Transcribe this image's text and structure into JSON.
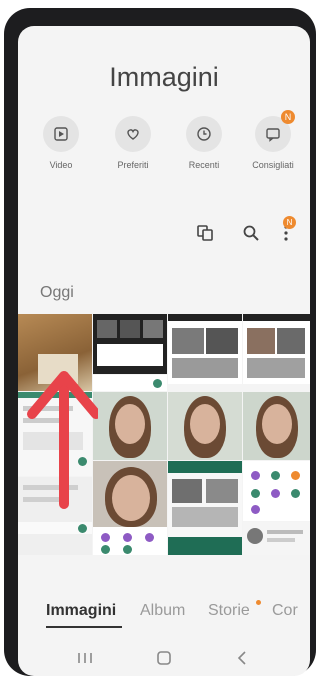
{
  "header": {
    "title": "Immagini"
  },
  "quick_actions": [
    {
      "label": "Video",
      "icon": "video-icon"
    },
    {
      "label": "Preferiti",
      "icon": "heart-icon"
    },
    {
      "label": "Recenti",
      "icon": "clock-icon"
    },
    {
      "label": "Consigliati",
      "icon": "suggestions-icon",
      "badge": "N"
    }
  ],
  "toolbar": {
    "icons": [
      "select-multiple-icon",
      "search-icon",
      "more-options-icon"
    ],
    "more_badge": "N"
  },
  "section": {
    "title": "Oggi"
  },
  "tabs": [
    {
      "label": "Immagini",
      "active": true
    },
    {
      "label": "Album",
      "active": false
    },
    {
      "label": "Storie",
      "active": false,
      "dot": true
    },
    {
      "label": "Cor",
      "active": false
    }
  ],
  "nav": {
    "icons": [
      "recent-apps-icon",
      "home-icon",
      "back-icon"
    ]
  },
  "colors": {
    "accent": "#ee8a2f",
    "arrow": "#e8434a",
    "background": "#f4f4f4"
  }
}
